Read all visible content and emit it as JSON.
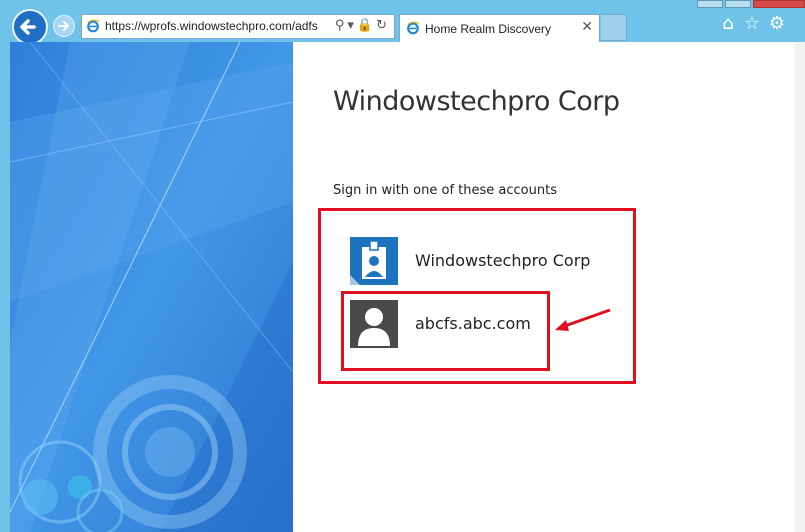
{
  "browser": {
    "address": "https://wprofs.windowstechpro.com/adfs",
    "tab_title": "Home Realm Discovery",
    "icons": [
      "back-icon",
      "forward-icon",
      "ie-icon",
      "search-icon",
      "dropdown-icon",
      "lock-icon",
      "refresh-icon",
      "close-icon",
      "home-icon",
      "favorites-star-icon",
      "settings-gear-icon"
    ]
  },
  "page": {
    "company_title": "Windowstechpro Corp",
    "instruction": "Sign in with one of these accounts",
    "accounts": [
      {
        "label": "Windowstechpro Corp",
        "icon": "badge-user-icon",
        "tile_color": "#1e73be"
      },
      {
        "label": "abcfs.abc.com",
        "icon": "generic-user-icon",
        "tile_color": "#4a4a4a"
      }
    ]
  },
  "colors": {
    "chrome": "#6fc3e8",
    "highlight": "#e00f1f",
    "art_blue": "#3d8fe0"
  }
}
